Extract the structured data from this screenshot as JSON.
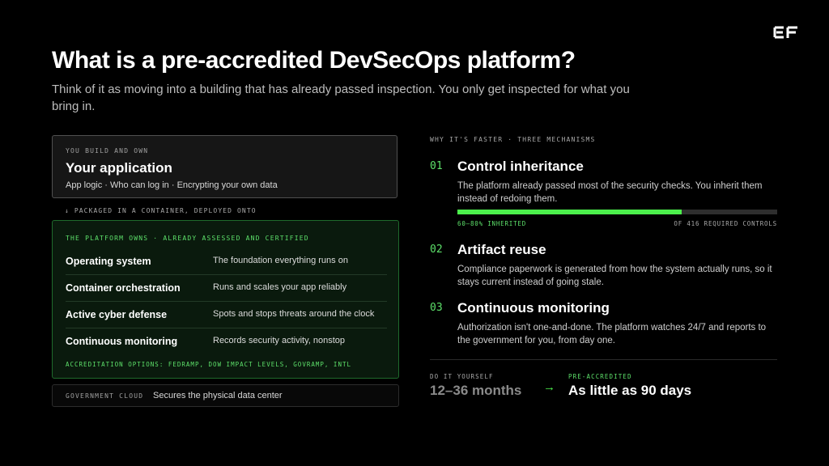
{
  "header": {
    "logo_icon": "ef-logo-icon",
    "title": "What is a pre-accredited DevSecOps platform?",
    "subtitle": "Think of it as moving into a building that has already passed inspection. You only get inspected for what you bring in."
  },
  "stack": {
    "app": {
      "eyebrow": "YOU BUILD AND OWN",
      "title": "Your application",
      "description": "App logic · Who can log in · Encrypting your own data"
    },
    "packaged_note": "↓ PACKAGED IN A CONTAINER, DEPLOYED ONTO",
    "platform": {
      "eyebrow": "THE PLATFORM OWNS · ALREADY ASSESSED AND CERTIFIED",
      "rows": [
        {
          "name": "Operating system",
          "description": "The foundation everything runs on"
        },
        {
          "name": "Container orchestration",
          "description": "Runs and scales your app reliably"
        },
        {
          "name": "Active cyber defense",
          "description": "Spots and stops threats around the clock"
        },
        {
          "name": "Continuous monitoring",
          "description": "Records security activity, nonstop"
        }
      ],
      "options": "ACCREDITATION OPTIONS: FEDRAMP, DOW IMPACT LEVELS, GOVRAMP, INTL"
    },
    "government": {
      "label": "GOVERNMENT CLOUD",
      "description": "Secures the physical data center"
    }
  },
  "mechanisms": {
    "eyebrow": "WHY IT'S FASTER · THREE MECHANISMS",
    "items": [
      {
        "number": "01",
        "title": "Control inheritance",
        "description": "The platform already passed most of the security checks. You inherit them instead of redoing them."
      },
      {
        "number": "02",
        "title": "Artifact reuse",
        "description": "Compliance paperwork is generated from how the system actually runs, so it stays current instead of going stale."
      },
      {
        "number": "03",
        "title": "Continuous monitoring",
        "description": "Authorization isn't one-and-done. The platform watches 24/7 and reports to the government for you, from day one."
      }
    ],
    "progress": {
      "left_label": "60–80% INHERITED",
      "right_label": "OF 416 REQUIRED CONTROLS",
      "fill_fraction": 0.7
    }
  },
  "comparison": {
    "diy_label": "DO IT YOURSELF",
    "diy_value": "12–36 months",
    "arrow": "→",
    "pre_label": "PRE-ACCREDITED",
    "pre_value": "As little as 90 days"
  },
  "colors": {
    "accent_green": "#4cf04c",
    "background": "#000000"
  }
}
